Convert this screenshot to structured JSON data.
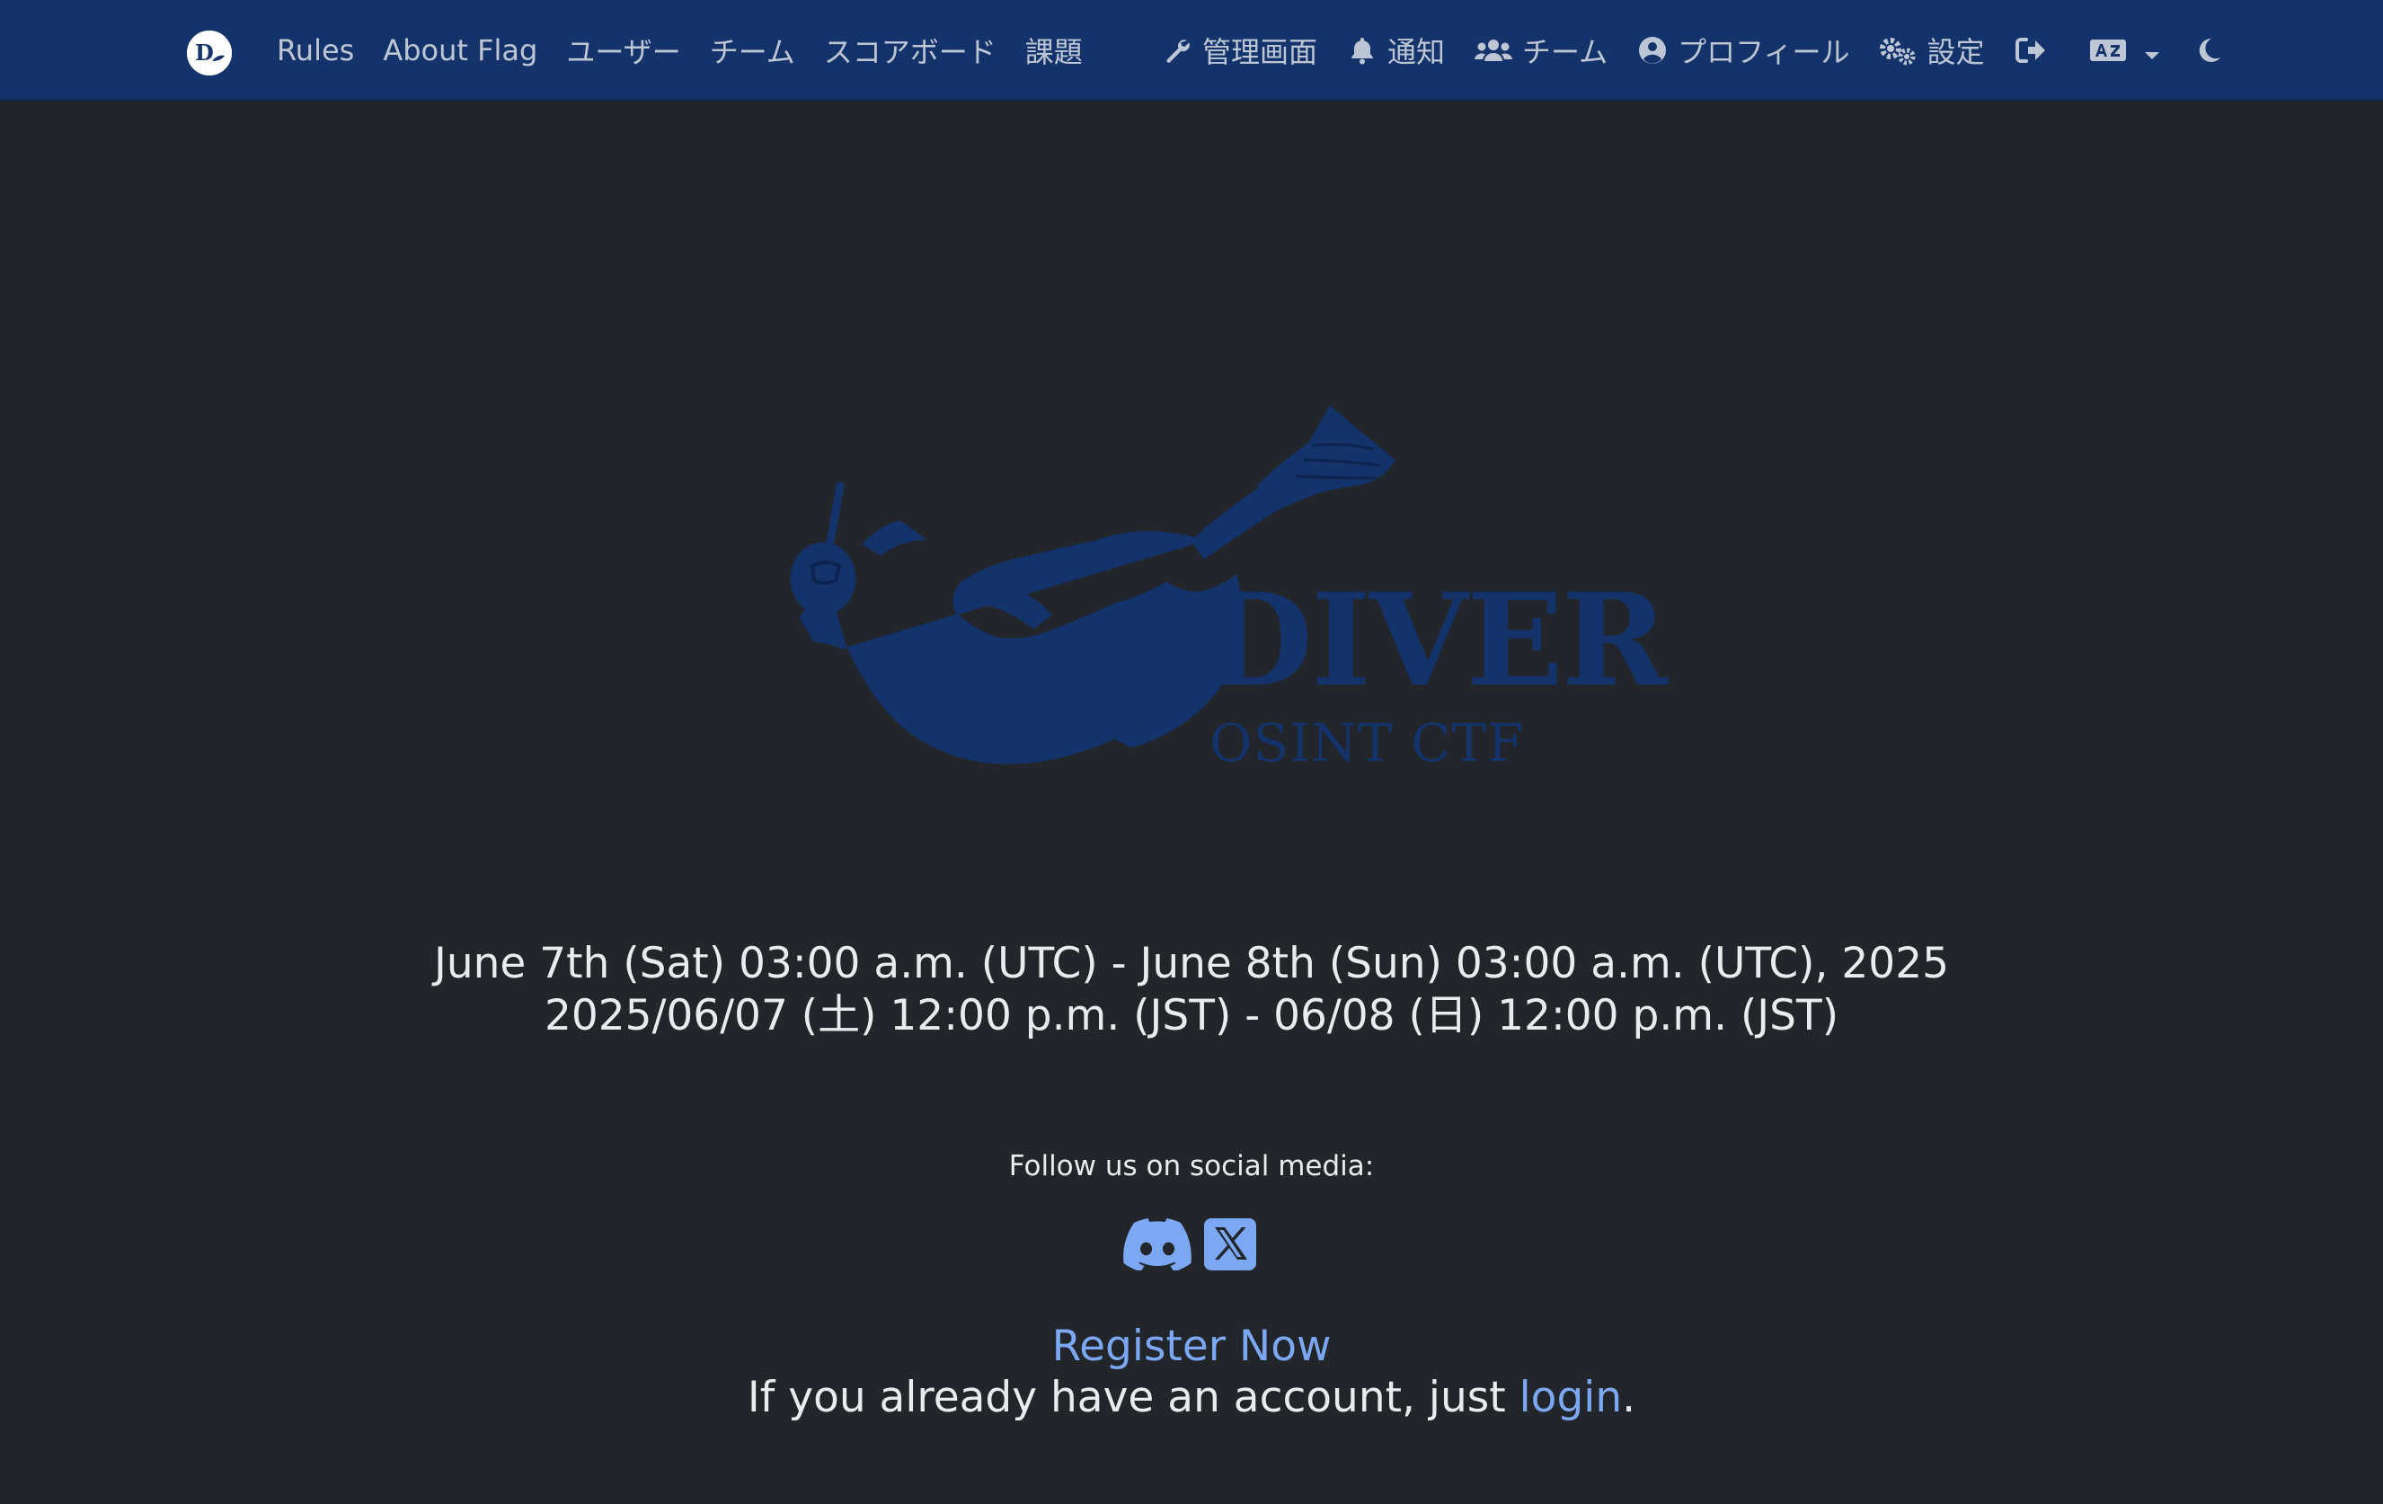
{
  "nav": {
    "left": [
      {
        "label": "Rules"
      },
      {
        "label": "About Flag"
      },
      {
        "label": "ユーザー"
      },
      {
        "label": "チーム"
      },
      {
        "label": "スコアボード"
      },
      {
        "label": "課題"
      }
    ],
    "right": [
      {
        "label": "管理画面",
        "icon": "wrench-icon"
      },
      {
        "label": "通知",
        "icon": "bell-icon"
      },
      {
        "label": "チーム",
        "icon": "users-icon"
      },
      {
        "label": "プロフィール",
        "icon": "user-circle-icon"
      },
      {
        "label": "設定",
        "icon": "gears-icon"
      }
    ],
    "icons": [
      "logout-icon",
      "language-icon",
      "moon-icon"
    ]
  },
  "logo": {
    "title": "DIVER",
    "subtitle": "OSINT CTF"
  },
  "event": {
    "utc": "June 7th (Sat) 03:00 a.m. (UTC) - June 8th (Sun) 03:00 a.m. (UTC), 2025",
    "jst": "2025/06/07 (土) 12:00 p.m. (JST) - 06/08 (日) 12:00 p.m. (JST)"
  },
  "social": {
    "heading": "Follow us on social media:",
    "icons": [
      "discord-icon",
      "x-icon"
    ]
  },
  "cta": {
    "register": "Register Now",
    "login_prefix": "If you already have an account, just ",
    "login_link": "login",
    "login_suffix": "."
  },
  "colors": {
    "navbar": "#14336a",
    "background": "#222529",
    "link": "#7ca7f3",
    "logo": "#14336a"
  }
}
